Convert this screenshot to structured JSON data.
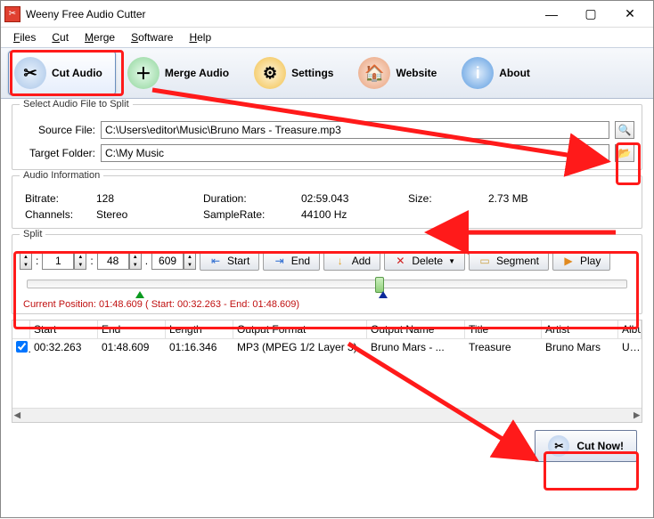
{
  "window": {
    "title": "Weeny Free Audio Cutter"
  },
  "menu": {
    "files": "Files",
    "cut": "Cut",
    "merge": "Merge",
    "software": "Software",
    "help": "Help"
  },
  "toolbar": {
    "cut": "Cut Audio",
    "merge": "Merge Audio",
    "settings": "Settings",
    "website": "Website",
    "about": "About"
  },
  "select_group": {
    "legend": "Select Audio File to Split",
    "source_label": "Source File:",
    "source_value": "C:\\Users\\editor\\Music\\Bruno Mars - Treasure.mp3",
    "target_label": "Target Folder:",
    "target_value": "C:\\My Music"
  },
  "info_group": {
    "legend": "Audio Information",
    "bitrate_label": "Bitrate:",
    "bitrate": "128",
    "duration_label": "Duration:",
    "duration": "02:59.043",
    "size_label": "Size:",
    "size": "2.73 MB",
    "channels_label": "Channels:",
    "channels": "Stereo",
    "samplerate_label": "SampleRate:",
    "samplerate": "44100 Hz"
  },
  "split": {
    "legend": "Split",
    "mm": "1",
    "ss": "48",
    "ms": "609",
    "start_btn": "Start",
    "end_btn": "End",
    "add_btn": "Add",
    "delete_btn": "Delete",
    "segment_btn": "Segment",
    "play_btn": "Play",
    "position": "Current Position: 01:48.609 ( Start: 00:32.263 - End: 01:48.609)"
  },
  "table": {
    "headers": [
      "",
      "Start",
      "End",
      "Length",
      "Output Format",
      "Output Name",
      "Title",
      "Artist",
      "Album"
    ],
    "rows": [
      {
        "checked": true,
        "start": "00:32.263",
        "end": "01:48.609",
        "length": "01:16.346",
        "format": "MP3 (MPEG 1/2 Layer 3)",
        "name": "Bruno Mars - ...",
        "title": "Treasure",
        "artist": "Bruno Mars",
        "album": "Unorthodox"
      }
    ]
  },
  "footer": {
    "cutnow": "Cut Now!"
  }
}
